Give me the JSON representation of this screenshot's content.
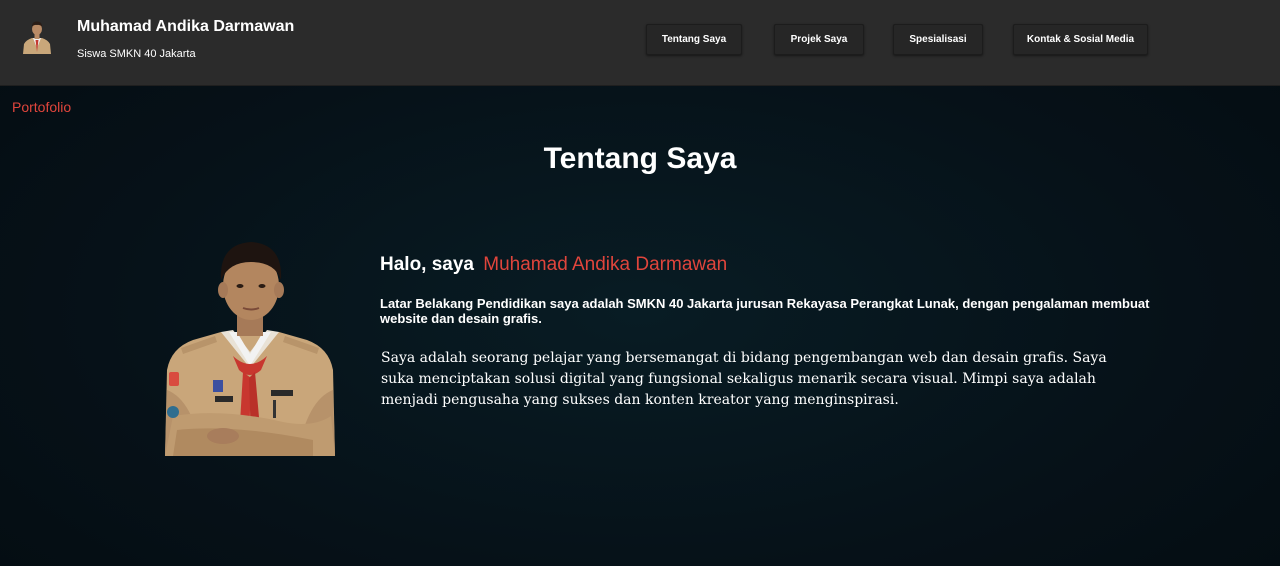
{
  "header": {
    "name": "Muhamad Andika Darmawan",
    "subtitle": "Siswa SMKN 40 Jakarta"
  },
  "nav": {
    "items": [
      {
        "label": "Tentang Saya"
      },
      {
        "label": "Projek Saya"
      },
      {
        "label": "Spesialisasi"
      },
      {
        "label": "Kontak & Sosial Media"
      }
    ]
  },
  "breadcrumb": "Portofolio",
  "section": {
    "title": "Tentang Saya",
    "greeting_prefix": "Halo, saya",
    "greeting_name": "Muhamad Andika Darmawan",
    "education": "Latar Belakang Pendidikan saya adalah SMKN 40 Jakarta jurusan Rekayasa Perangkat Lunak, dengan pengalaman membuat website dan desain grafis.",
    "bio": "Saya adalah seorang pelajar yang bersemangat di bidang pengembangan web dan desain grafis. Saya suka menciptakan solusi digital yang fungsional sekaligus menarik secara visual. Mimpi saya adalah menjadi pengusaha yang sukses dan konten kreator yang menginspirasi."
  },
  "colors": {
    "accent": "#e0453c",
    "header_bg": "#2b2b2b",
    "page_bg": "#06141b"
  }
}
